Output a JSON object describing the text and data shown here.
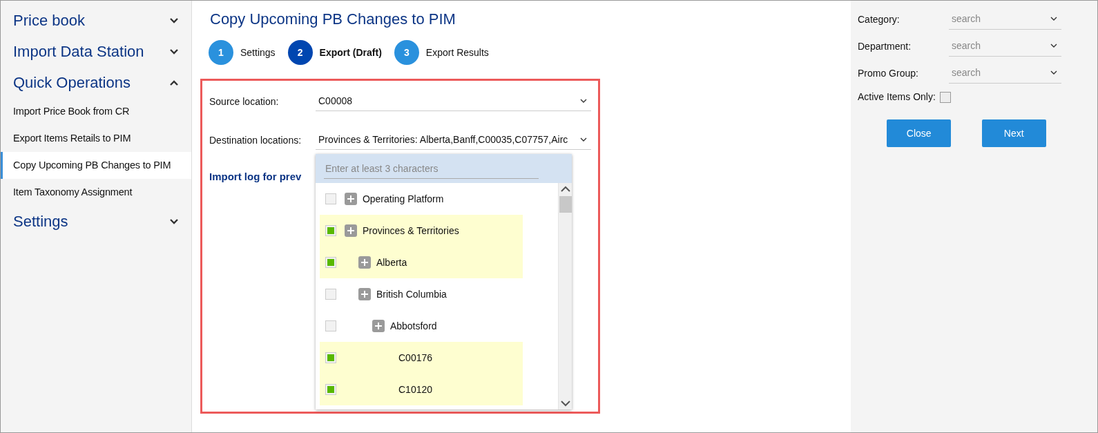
{
  "sidebar": {
    "sections": [
      {
        "title": "Price book",
        "expanded": false
      },
      {
        "title": "Import Data Station",
        "expanded": false
      },
      {
        "title": "Quick Operations",
        "expanded": true,
        "items": [
          {
            "label": "Import Price Book from CR",
            "selected": false
          },
          {
            "label": "Export Items Retails to PIM",
            "selected": false
          },
          {
            "label": "Copy Upcoming PB Changes to PIM",
            "selected": true
          },
          {
            "label": "Item Taxonomy Assignment",
            "selected": false
          }
        ]
      },
      {
        "title": "Settings",
        "expanded": false
      }
    ]
  },
  "page": {
    "title": "Copy Upcoming PB Changes to PIM",
    "steps": [
      {
        "number": "1",
        "label": "Settings",
        "selected": false
      },
      {
        "number": "2",
        "label": "Export (Draft)",
        "selected": true
      },
      {
        "number": "3",
        "label": "Export Results",
        "selected": false
      }
    ],
    "source": {
      "label": "Source location:",
      "value": "C00008"
    },
    "destination": {
      "label": "Destination locations:",
      "value": "Provinces & Territories: Alberta,Banff,C00035,C07757,Airc"
    },
    "import_log": "Import log for prev",
    "dropdown": {
      "placeholder": "Enter at least 3 characters",
      "tree": [
        {
          "label": "Operating Platform",
          "kind": "group",
          "checked": false
        },
        {
          "label": "Provinces & Territories",
          "kind": "group",
          "checked": true,
          "children": [
            {
              "label": "Alberta",
              "kind": "group",
              "checked": true
            },
            {
              "label": "British Columbia",
              "kind": "group",
              "checked": false,
              "children": [
                {
                  "label": "Abbotsford",
                  "kind": "group",
                  "checked": false,
                  "children": [
                    {
                      "label": "C00176",
                      "kind": "leaf",
                      "checked": true
                    },
                    {
                      "label": "C10120",
                      "kind": "leaf",
                      "checked": true
                    }
                  ]
                }
              ]
            }
          ]
        }
      ]
    }
  },
  "filters": {
    "fields": [
      {
        "label": "Category:",
        "placeholder": "search"
      },
      {
        "label": "Department:",
        "placeholder": "search"
      },
      {
        "label": "Promo Group:",
        "placeholder": "search"
      }
    ],
    "active_only": {
      "label": "Active Items Only:",
      "checked": false
    },
    "buttons": [
      "Close",
      "Next"
    ]
  }
}
